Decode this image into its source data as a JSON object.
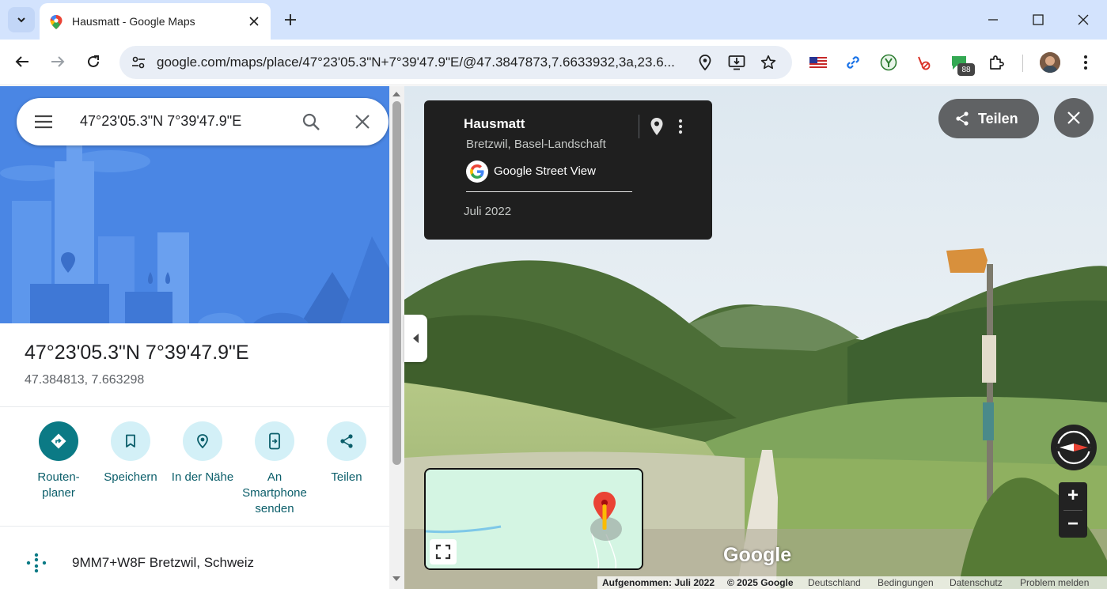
{
  "browser": {
    "tab_title": "Hausmatt - Google Maps",
    "url": "google.com/maps/place/47°23'05.3\"N+7°39'47.9\"E/@47.3847873,7.6633932,3a,23.6...",
    "extension_badge": "88"
  },
  "search": {
    "value": "47°23'05.3\"N 7°39'47.9\"E"
  },
  "place": {
    "title": "47°23'05.3\"N 7°39'47.9\"E",
    "coordinates": "47.384813, 7.663298"
  },
  "actions": [
    {
      "label": "Routen-\nplaner",
      "icon": "directions-icon"
    },
    {
      "label": "Speichern",
      "icon": "bookmark-icon"
    },
    {
      "label": "In der Nähe",
      "icon": "nearby-icon"
    },
    {
      "label": "An\nSmartphone\nsenden",
      "icon": "send-to-phone-icon"
    },
    {
      "label": "Teilen",
      "icon": "share-icon"
    }
  ],
  "plus_code": {
    "text": "9MM7+W8F Bretzwil, Schweiz"
  },
  "street_view": {
    "card_title": "Hausmatt",
    "card_subtitle": "Bretzwil, Basel-Landschaft",
    "brand": "Google Street View",
    "date": "Juli 2022",
    "share_label": "Teilen",
    "watermark": "Google",
    "zoom_in": "+",
    "zoom_out": "−"
  },
  "footer": {
    "captured": "Aufgenommen: Juli 2022",
    "copyright": "© 2025 Google",
    "country": "Deutschland",
    "terms": "Bedingungen",
    "privacy": "Datenschutz",
    "report": "Problem melden"
  },
  "colors": {
    "accent_teal": "#0b7a85",
    "hero_blue": "#4a86e4",
    "tab_bar": "#d3e3fd"
  }
}
